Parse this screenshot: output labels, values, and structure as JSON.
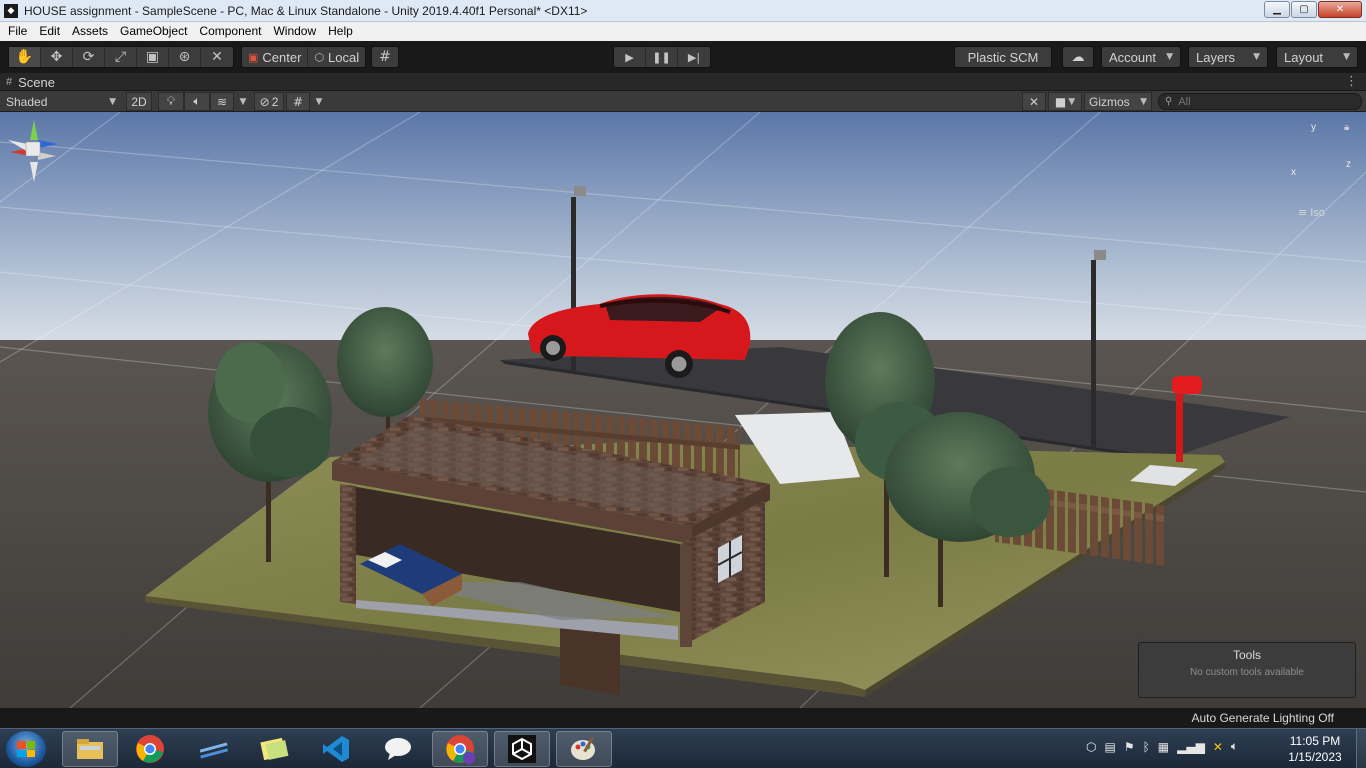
{
  "window": {
    "title": "HOUSE  assignment - SampleScene - PC, Mac & Linux Standalone - Unity 2019.4.40f1 Personal* <DX11>",
    "app_icon": "unity-logo-icon",
    "controls": {
      "minimize": "▁",
      "maximize": "▢",
      "close": "✕"
    }
  },
  "menu": [
    "File",
    "Edit",
    "Assets",
    "GameObject",
    "Component",
    "Window",
    "Help"
  ],
  "toolbar": {
    "transform_tools": [
      "hand-tool",
      "move-tool",
      "rotate-tool",
      "scale-tool",
      "rect-tool",
      "transform-tool",
      "custom-editor-tool"
    ],
    "pivot_mode": "Center",
    "pivot_rotation": "Local",
    "grid_snap": "grid-snap-icon",
    "playback": [
      "play-icon",
      "pause-icon",
      "step-icon"
    ],
    "plastic_scm": "Plastic SCM",
    "cloud": "cloud-icon",
    "account": "Account",
    "layers": "Layers",
    "layout": "Layout"
  },
  "scene_tab": {
    "label": "Scene",
    "icon": "#"
  },
  "scene_toolbar": {
    "draw_mode": "Shaded",
    "mode_2d": "2D",
    "hidden_count": "2",
    "gizmos": "Gizmos",
    "search_placeholder": "All"
  },
  "viewport": {
    "orientation_gizmo": {
      "x": "x",
      "y": "y",
      "z": "z",
      "projection": "Iso"
    },
    "tools_overlay": {
      "title": "Tools",
      "subtitle": "No custom tools available"
    }
  },
  "status": {
    "lighting": "Auto Generate Lighting Off"
  },
  "taskbar": {
    "apps": [
      "file-explorer-icon",
      "chrome-icon",
      "snipping-tool-icon",
      "sticky-notes-icon",
      "vscode-icon",
      "messaging-icon",
      "chrome-profile-icon",
      "unity-icon",
      "paint-icon"
    ],
    "clock_time": "11:05 PM",
    "clock_date": "1/15/2023"
  }
}
